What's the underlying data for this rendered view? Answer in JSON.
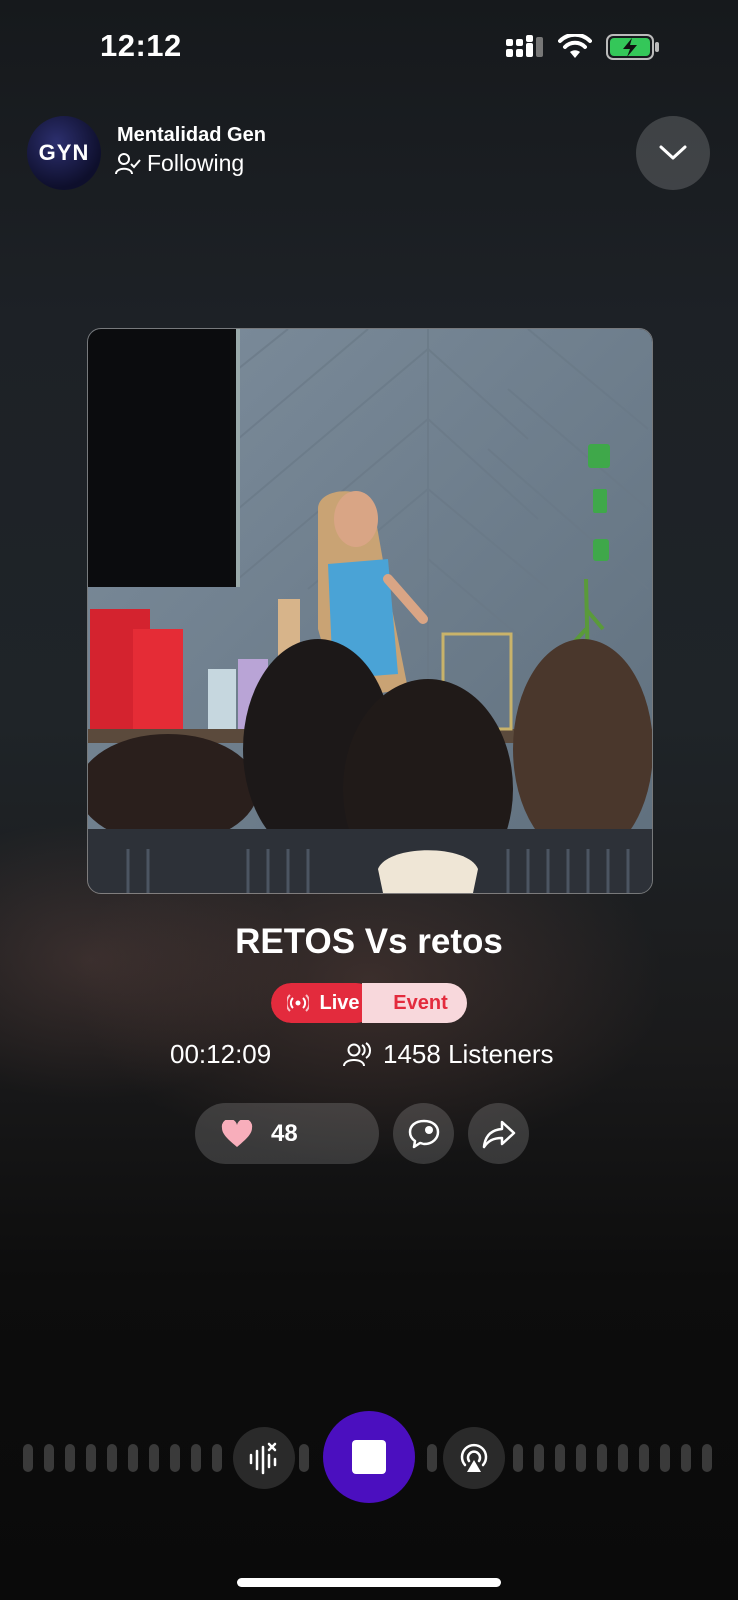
{
  "status_bar": {
    "time": "12:12",
    "icons": [
      "cellular-signal-icon",
      "wifi-icon",
      "battery-charging-icon"
    ],
    "battery_color": "#34c759"
  },
  "header": {
    "avatar_text": "GYN",
    "channel_name": "Mentalidad Gen",
    "follow_status": "Following",
    "collapse_icon": "chevron-down-icon"
  },
  "episode": {
    "title": "RETOS Vs retos",
    "badge_live": "Live",
    "badge_event": "Event",
    "elapsed": "00:12:09",
    "listeners": "1458 Listeners"
  },
  "actions": {
    "likes": "48",
    "icons": [
      "heart-icon",
      "comment-icon",
      "share-icon"
    ]
  },
  "player": {
    "left_icon": "noise-cancel-icon",
    "center_icon": "stop-icon",
    "right_icon": "airplay-audio-icon",
    "accent_color": "#4b0fbf"
  },
  "colors": {
    "live_red": "#e32b3d",
    "event_pink": "#f8d8dc"
  }
}
